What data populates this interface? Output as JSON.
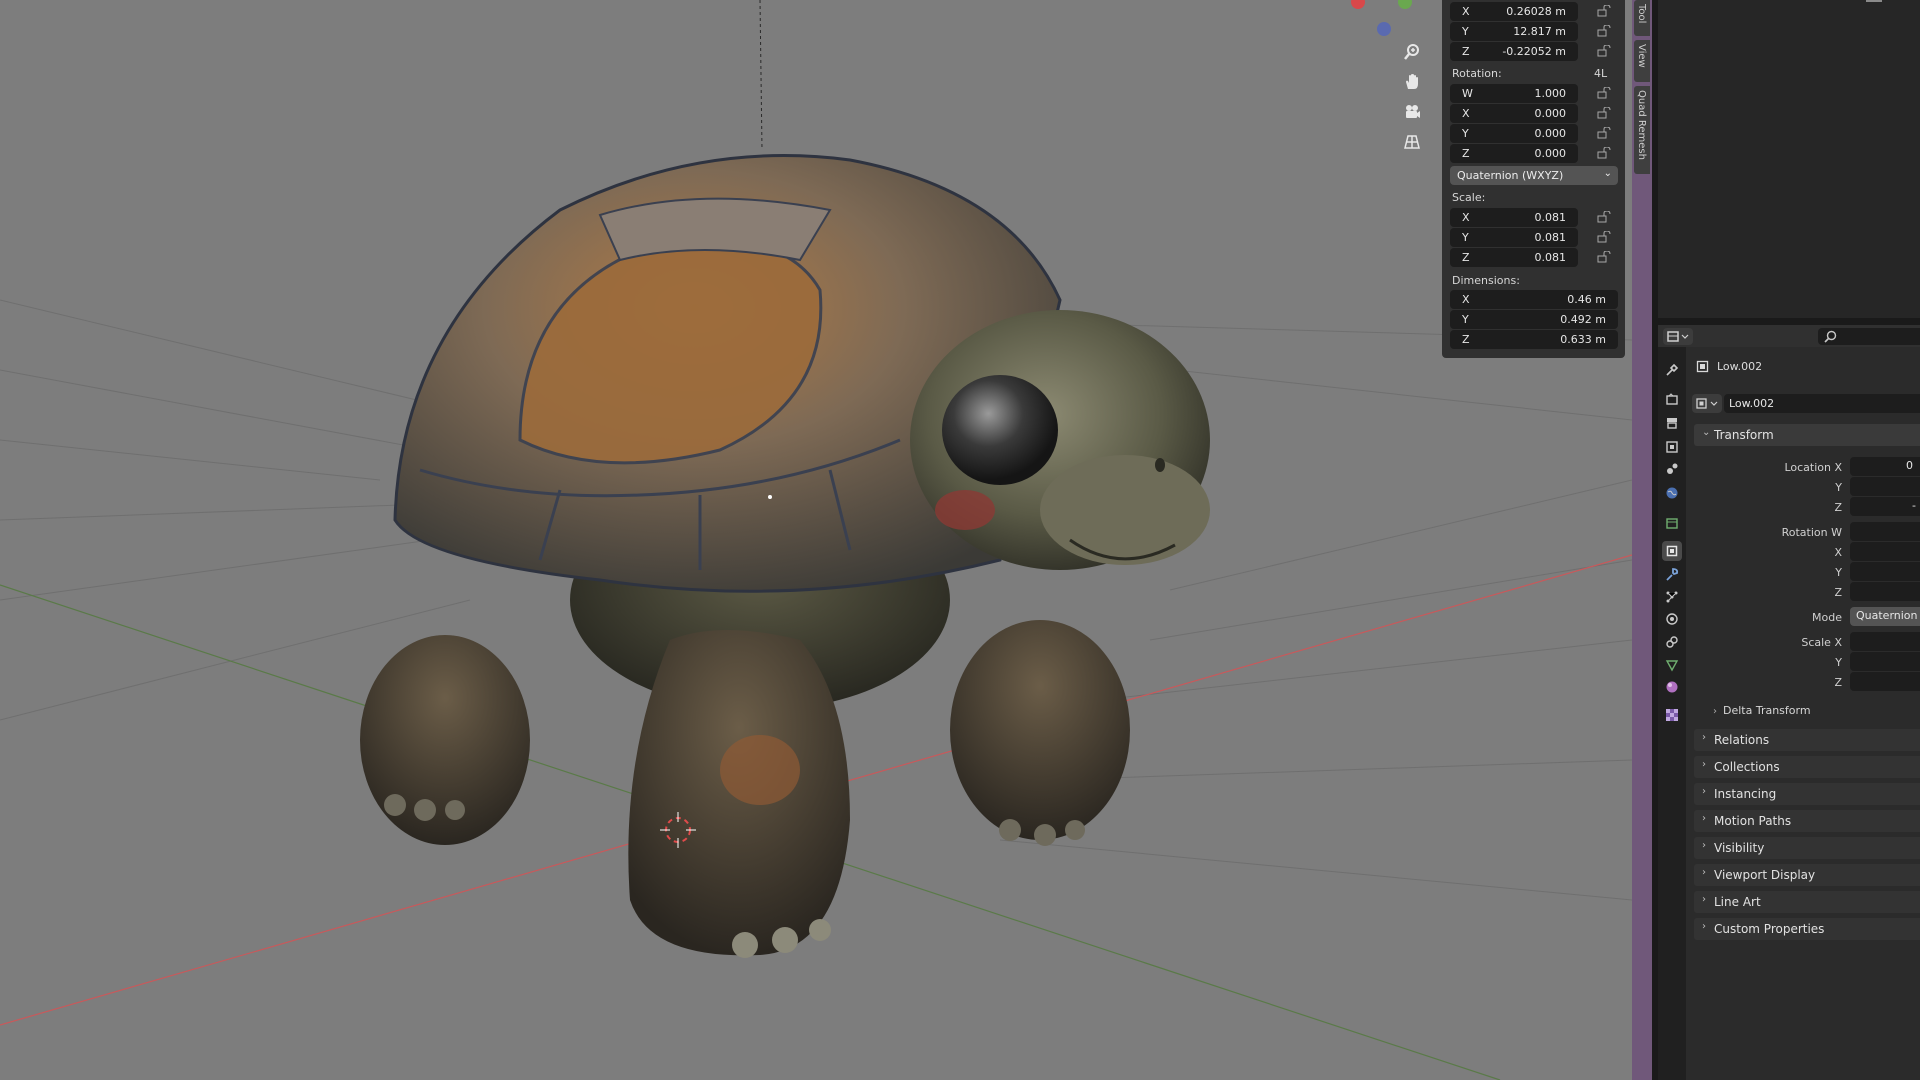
{
  "npanel": {
    "location": [
      {
        "axis": "X",
        "value": "0.26028 m"
      },
      {
        "axis": "Y",
        "value": "12.817 m"
      },
      {
        "axis": "Z",
        "value": "-0.22052 m"
      }
    ],
    "rotation_label": "Rotation:",
    "rotation_mode_short": "4L",
    "rotation": [
      {
        "axis": "W",
        "value": "1.000"
      },
      {
        "axis": "X",
        "value": "0.000"
      },
      {
        "axis": "Y",
        "value": "0.000"
      },
      {
        "axis": "Z",
        "value": "0.000"
      }
    ],
    "rotation_mode": "Quaternion (WXYZ)",
    "scale_label": "Scale:",
    "scale": [
      {
        "axis": "X",
        "value": "0.081"
      },
      {
        "axis": "Y",
        "value": "0.081"
      },
      {
        "axis": "Z",
        "value": "0.081"
      }
    ],
    "dimensions_label": "Dimensions:",
    "dimensions": [
      {
        "axis": "X",
        "value": "0.46 m"
      },
      {
        "axis": "Y",
        "value": "0.492 m"
      },
      {
        "axis": "Z",
        "value": "0.633 m"
      }
    ]
  },
  "sidetabs": [
    "Tool",
    "View",
    "Quad Remesh"
  ],
  "viewport_tools": [
    "zoom-icon",
    "hand-icon",
    "camera-icon",
    "grid-icon"
  ],
  "properties": {
    "object_name": "Low.002",
    "datablock_name": "Low.002",
    "transform_label": "Transform",
    "location_x_label": "Location X",
    "y_label": "Y",
    "z_label": "Z",
    "rotation_w_label": "Rotation W",
    "x_label": "X",
    "mode_label": "Mode",
    "mode_value": "Quaternion (",
    "scale_x_label": "Scale X",
    "location_x_value": "0",
    "location_z_value": "-",
    "delta_transform": "Delta Transform",
    "panels": [
      "Relations",
      "Collections",
      "Instancing",
      "Motion Paths",
      "Visibility",
      "Viewport Display",
      "Line Art",
      "Custom Properties"
    ]
  },
  "colors": {
    "viewport_bg": "#7d7d7d",
    "panel_bg": "#303030",
    "field_bg": "#1d1d1d",
    "sidetab_accent": "#70587a",
    "x_axis": "#c8595b",
    "y_axis": "#5a7a48"
  }
}
